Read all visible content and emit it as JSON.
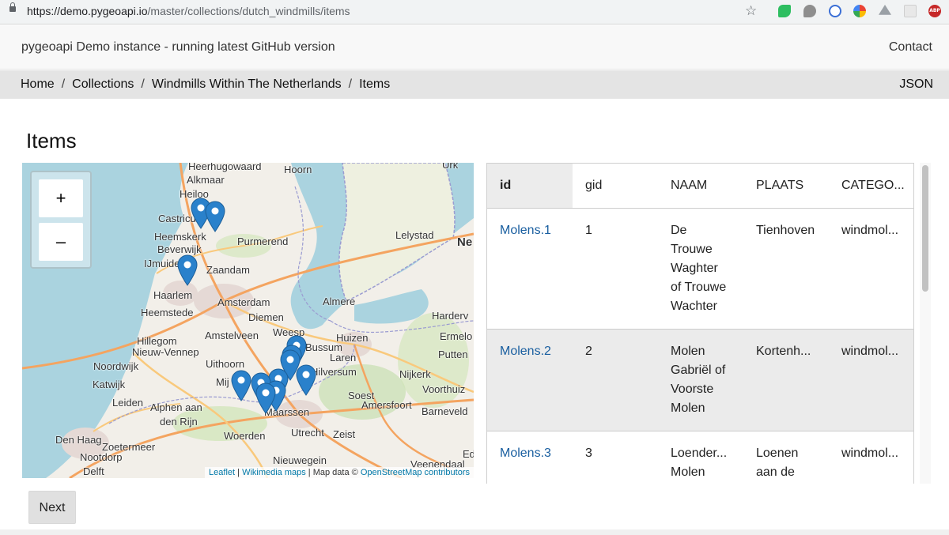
{
  "browser": {
    "url_host": "https://demo.pygeoapi.io",
    "url_path": "/master/collections/dutch_windmills/items",
    "extensions": [
      "evernote-icon",
      "speech-bubble-icon",
      "circle-extension-icon",
      "chrome-color-icon",
      "drive-icon",
      "grid-extension-icon",
      "adblock-plus-icon"
    ],
    "abp_label": "ABP"
  },
  "navbar": {
    "brand": "pygeoapi Demo instance - running latest GitHub version",
    "contact": "Contact"
  },
  "breadcrumb": {
    "items": [
      "Home",
      "Collections",
      "Windmills Within The Netherlands",
      "Items"
    ],
    "separator": "/",
    "json_link": "JSON"
  },
  "page": {
    "title": "Items"
  },
  "map": {
    "zoom_in": "+",
    "zoom_out": "–",
    "labels": [
      "Heerhugowaard",
      "Hoorn",
      "Urk",
      "Alkmaar",
      "Heiloo",
      "Castricum",
      "Heemskerk",
      "Beverwijk",
      "Purmerend",
      "Lelystad",
      "Ne",
      "IJmuiden",
      "Zaandam",
      "Haarlem",
      "Amsterdam",
      "Almere",
      "Heemstede",
      "Diemen",
      "Harderv",
      "Hillegom",
      "Amstelveen",
      "Weesp",
      "Huizen",
      "Ermelo",
      "Nieuw-Vennep",
      "Bussum",
      "Laren",
      "Putten",
      "Noordwijk",
      "Uithoorn",
      "Hilversum",
      "Nijkerk",
      "Katwijk",
      "Mij",
      "Voorthuiz",
      "Leiden",
      "Alphen aan",
      "Soest",
      "Amersfoort",
      "den Rijn",
      "Maarssen",
      "Barneveld",
      "Utrecht",
      "Zeist",
      "Den Haag",
      "Woerden",
      "Zoetermeer",
      "Nootdorp",
      "Ede",
      "Delft",
      "Nieuwegein",
      "Veenendaal"
    ],
    "attribution": {
      "leaflet": "Leaflet",
      "sep": " | ",
      "wikimedia": "Wikimedia maps",
      "mapdata": " | Map data © ",
      "osm": "OpenStreetMap contributors"
    },
    "colors": {
      "water": "#aad3df",
      "land": "#f2efe9",
      "marker": "#2a81cb"
    }
  },
  "table": {
    "columns": [
      "id",
      "gid",
      "NAAM",
      "PLAATS",
      "CATEGO..."
    ],
    "rows": [
      {
        "id": "Molens.1",
        "gid": "1",
        "naam": "De Trouwe Waghter of Trouwe Wachter",
        "plaats": "Tienhoven",
        "categorie": "windmol..."
      },
      {
        "id": "Molens.2",
        "gid": "2",
        "naam": "Molen Gabriël of Voorste Molen",
        "plaats": "Kortenh...",
        "categorie": "windmol..."
      },
      {
        "id": "Molens.3",
        "gid": "3",
        "naam": "Loender... Molen",
        "plaats": "Loenen aan de",
        "categorie": "windmol..."
      }
    ]
  },
  "pagination": {
    "next": "Next"
  }
}
